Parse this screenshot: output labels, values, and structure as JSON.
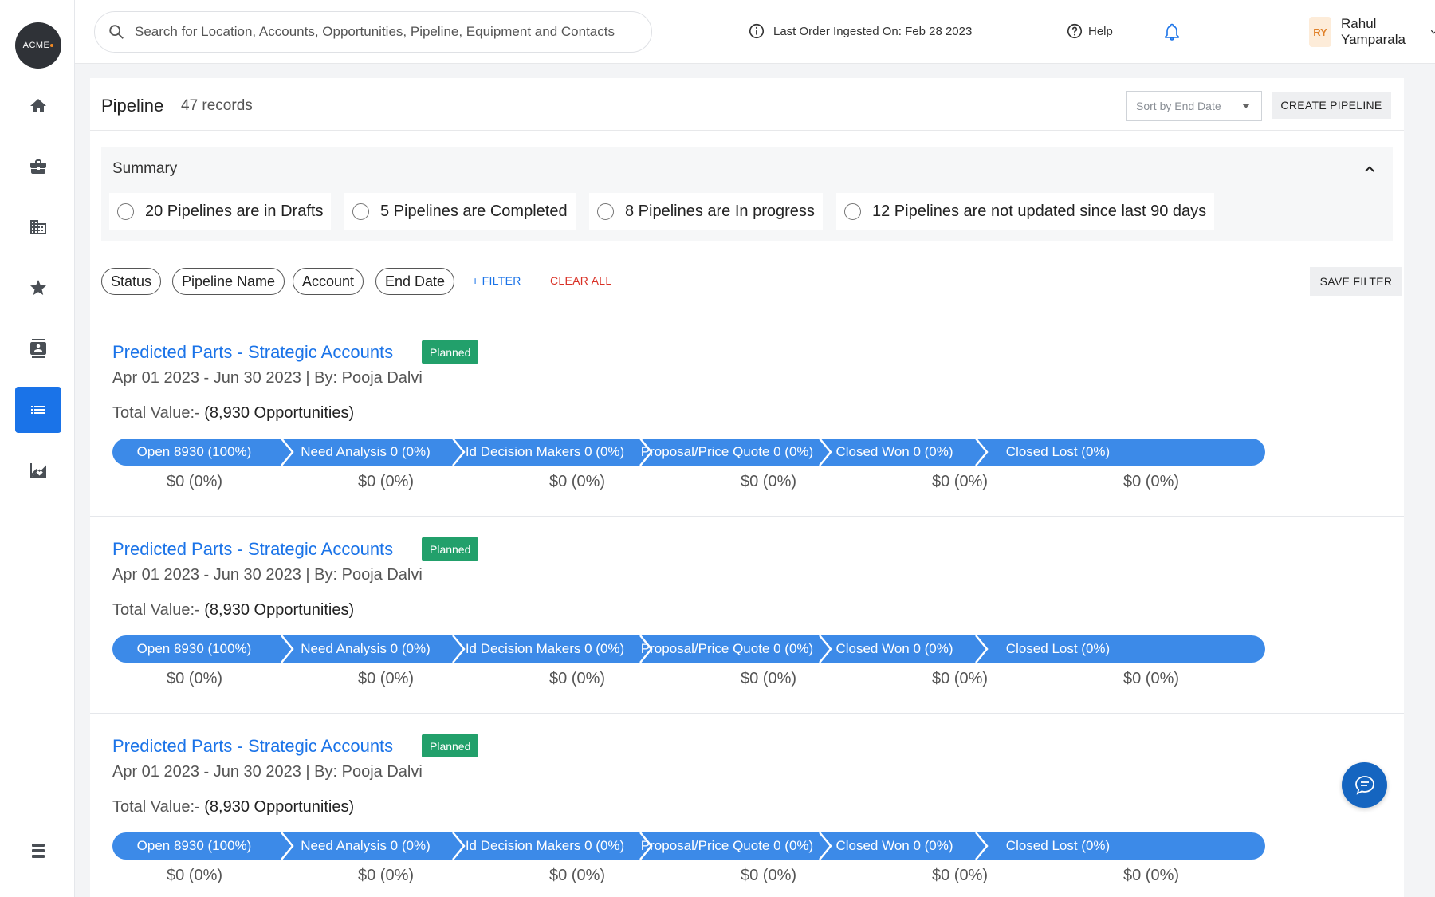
{
  "brand": {
    "logo_text": "ACME"
  },
  "search": {
    "placeholder": "Search for Location, Accounts, Opportunities, Pipeline, Equipment and Contacts"
  },
  "header": {
    "last_order": "Last Order Ingested On: Feb 28 2023",
    "help": "Help",
    "user_initials": "RY",
    "user_name": "Rahul Yamparala"
  },
  "sidebar": {
    "items": [
      {
        "icon": "home-icon"
      },
      {
        "icon": "briefcase-icon"
      },
      {
        "icon": "building-icon"
      },
      {
        "icon": "star-icon"
      },
      {
        "icon": "contacts-icon"
      },
      {
        "icon": "list-icon",
        "active": true
      },
      {
        "icon": "chart-icon"
      }
    ],
    "bottom_icon": "menu-icon"
  },
  "page": {
    "title": "Pipeline",
    "records": "47 records",
    "sort_label": "Sort by End Date",
    "create_label": "CREATE PIPELINE"
  },
  "summary": {
    "title": "Summary",
    "items": [
      "20 Pipelines are in Drafts",
      "5 Pipelines are Completed",
      "8 Pipelines are In progress",
      "12 Pipelines are not updated since last 90 days"
    ]
  },
  "filters": {
    "chips": [
      "Status",
      "Pipeline Name",
      "Account",
      "End Date"
    ],
    "add_filter": "+ FILTER",
    "clear_all": "CLEAR ALL",
    "save_filter": "SAVE FILTER"
  },
  "pipelines": [
    {
      "title": "Predicted Parts - Strategic Accounts",
      "status": "Planned",
      "meta": "Apr 01 2023 - Jun 30 2023 | By: Pooja Dalvi",
      "total_label": "Total Value:-",
      "total_value": "(8,930 Opportunities)",
      "stages": [
        "Open 8930 (100%)",
        "Need Analysis 0 (0%)",
        "Id Decision Makers 0 (0%)",
        "Proposal/Price Quote 0 (0%)",
        "Closed Won 0 (0%)",
        "Closed Lost (0%)"
      ],
      "values": [
        "$0 (0%)",
        "$0 (0%)",
        "$0 (0%)",
        "$0 (0%)",
        "$0 (0%)",
        "$0 (0%)"
      ]
    },
    {
      "title": "Predicted Parts - Strategic Accounts",
      "status": "Planned",
      "meta": "Apr 01 2023 - Jun 30 2023 | By: Pooja Dalvi",
      "total_label": "Total Value:-",
      "total_value": "(8,930 Opportunities)",
      "stages": [
        "Open 8930 (100%)",
        "Need Analysis 0 (0%)",
        "Id Decision Makers 0 (0%)",
        "Proposal/Price Quote 0 (0%)",
        "Closed Won 0 (0%)",
        "Closed Lost (0%)"
      ],
      "values": [
        "$0 (0%)",
        "$0 (0%)",
        "$0 (0%)",
        "$0 (0%)",
        "$0 (0%)",
        "$0 (0%)"
      ]
    },
    {
      "title": "Predicted Parts - Strategic Accounts",
      "status": "Planned",
      "meta": "Apr 01 2023 - Jun 30 2023 | By: Pooja Dalvi",
      "total_label": "Total Value:-",
      "total_value": "(8,930 Opportunities)",
      "stages": [
        "Open 8930 (100%)",
        "Need Analysis 0 (0%)",
        "Id Decision Makers 0 (0%)",
        "Proposal/Price Quote 0 (0%)",
        "Closed Won 0 (0%)",
        "Closed Lost (0%)"
      ],
      "values": [
        "$0 (0%)",
        "$0 (0%)",
        "$0 (0%)",
        "$0 (0%)",
        "$0 (0%)",
        "$0 (0%)"
      ]
    }
  ],
  "colors": {
    "accent": "#1a73e8",
    "stage_bar": "#3c8ae8",
    "badge": "#22a06b",
    "danger": "#d93025",
    "fab": "#1565c0"
  },
  "fab": {
    "icon": "chat-icon"
  }
}
